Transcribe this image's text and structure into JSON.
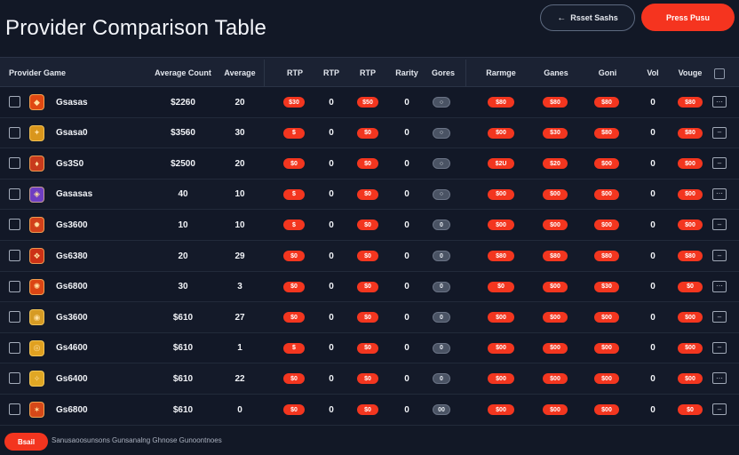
{
  "header": {
    "title": "Provider Comparison Table",
    "secondary_button": "Rsset Sashs",
    "secondary_icon": "arrow-left-icon",
    "primary_button": "Press Pusu"
  },
  "table": {
    "headers": [
      "Provider Game",
      "Average Count",
      "Average",
      "RTP",
      "RTP",
      "RTP",
      "Rarity",
      "Gores",
      "Rarmge",
      "Ganes",
      "Goni",
      "Vol",
      "Vouge"
    ],
    "rows": [
      {
        "provider": "Gsasas",
        "count": "$2260",
        "avg": "20",
        "p1": "$30",
        "v1": "0",
        "p2": "$50",
        "v2": "0",
        "toggle": "○",
        "p3": "$80",
        "p4": "$80",
        "p5": "$80",
        "v3": "0",
        "p6": "$80",
        "logo_color": "#e04812",
        "logo_glyph": "◆"
      },
      {
        "provider": "Gsasa0",
        "count": "$3560",
        "avg": "30",
        "p1": "$",
        "v1": "0",
        "p2": "$0",
        "v2": "0",
        "toggle": "○",
        "p3": "$00",
        "p4": "$30",
        "p5": "$80",
        "v3": "0",
        "p6": "$80",
        "logo_color": "#d9961c",
        "logo_glyph": "✦"
      },
      {
        "provider": "Gs3S0",
        "count": "$2500",
        "avg": "20",
        "p1": "$0",
        "v1": "0",
        "p2": "$0",
        "v2": "0",
        "toggle": "○",
        "p3": "$2U",
        "p4": "$20",
        "p5": "$00",
        "v3": "0",
        "p6": "$00",
        "logo_color": "#c83a1c",
        "logo_glyph": "♦"
      },
      {
        "provider": "Gasasas",
        "count": "40",
        "avg": "10",
        "p1": "$",
        "v1": "0",
        "p2": "$0",
        "v2": "0",
        "toggle": "○",
        "p3": "$00",
        "p4": "$00",
        "p5": "$00",
        "v3": "0",
        "p6": "$00",
        "logo_color": "#6e3ec2",
        "logo_glyph": "◈"
      },
      {
        "provider": "Gs3600",
        "count": "10",
        "avg": "10",
        "p1": "$",
        "v1": "0",
        "p2": "$0",
        "v2": "0",
        "toggle": "0",
        "p3": "$00",
        "p4": "$00",
        "p5": "$00",
        "v3": "0",
        "p6": "$00",
        "logo_color": "#d2401a",
        "logo_glyph": "✹"
      },
      {
        "provider": "Gs6380",
        "count": "20",
        "avg": "29",
        "p1": "$0",
        "v1": "0",
        "p2": "$0",
        "v2": "0",
        "toggle": "0",
        "p3": "$80",
        "p4": "$80",
        "p5": "$80",
        "v3": "0",
        "p6": "$80",
        "logo_color": "#cc3116",
        "logo_glyph": "❖"
      },
      {
        "provider": "Gs6800",
        "count": "30",
        "avg": "3",
        "p1": "$0",
        "v1": "0",
        "p2": "$0",
        "v2": "0",
        "toggle": "0",
        "p3": "$0",
        "p4": "$00",
        "p5": "$30",
        "v3": "0",
        "p6": "$0",
        "logo_color": "#db4514",
        "logo_glyph": "✺"
      },
      {
        "provider": "Gs3600",
        "count": "$610",
        "avg": "27",
        "p1": "$0",
        "v1": "0",
        "p2": "$0",
        "v2": "0",
        "toggle": "0",
        "p3": "$00",
        "p4": "$00",
        "p5": "$00",
        "v3": "0",
        "p6": "$00",
        "logo_color": "#d69b24",
        "logo_glyph": "◉"
      },
      {
        "provider": "Gs4600",
        "count": "$610",
        "avg": "1",
        "p1": "$",
        "v1": "0",
        "p2": "$0",
        "v2": "0",
        "toggle": "0",
        "p3": "$00",
        "p4": "$00",
        "p5": "$00",
        "v3": "0",
        "p6": "$00",
        "logo_color": "#e0a020",
        "logo_glyph": "◎"
      },
      {
        "provider": "Gs6400",
        "count": "$610",
        "avg": "22",
        "p1": "$0",
        "v1": "0",
        "p2": "$0",
        "v2": "0",
        "toggle": "0",
        "p3": "$00",
        "p4": "$00",
        "p5": "$00",
        "v3": "0",
        "p6": "$00",
        "logo_color": "#e0a724",
        "logo_glyph": "✧"
      },
      {
        "provider": "Gs6800",
        "count": "$610",
        "avg": "0",
        "p1": "$0",
        "v1": "0",
        "p2": "$0",
        "v2": "0",
        "toggle": "00",
        "p3": "$00",
        "p4": "$00",
        "p5": "$00",
        "v3": "0",
        "p6": "$0",
        "logo_color": "#d64818",
        "logo_glyph": "✶"
      }
    ]
  },
  "footer": {
    "button": "Bsail",
    "text": "Sanusaoosunsons Gunsanalng Ghnose Gunoontnoes"
  }
}
